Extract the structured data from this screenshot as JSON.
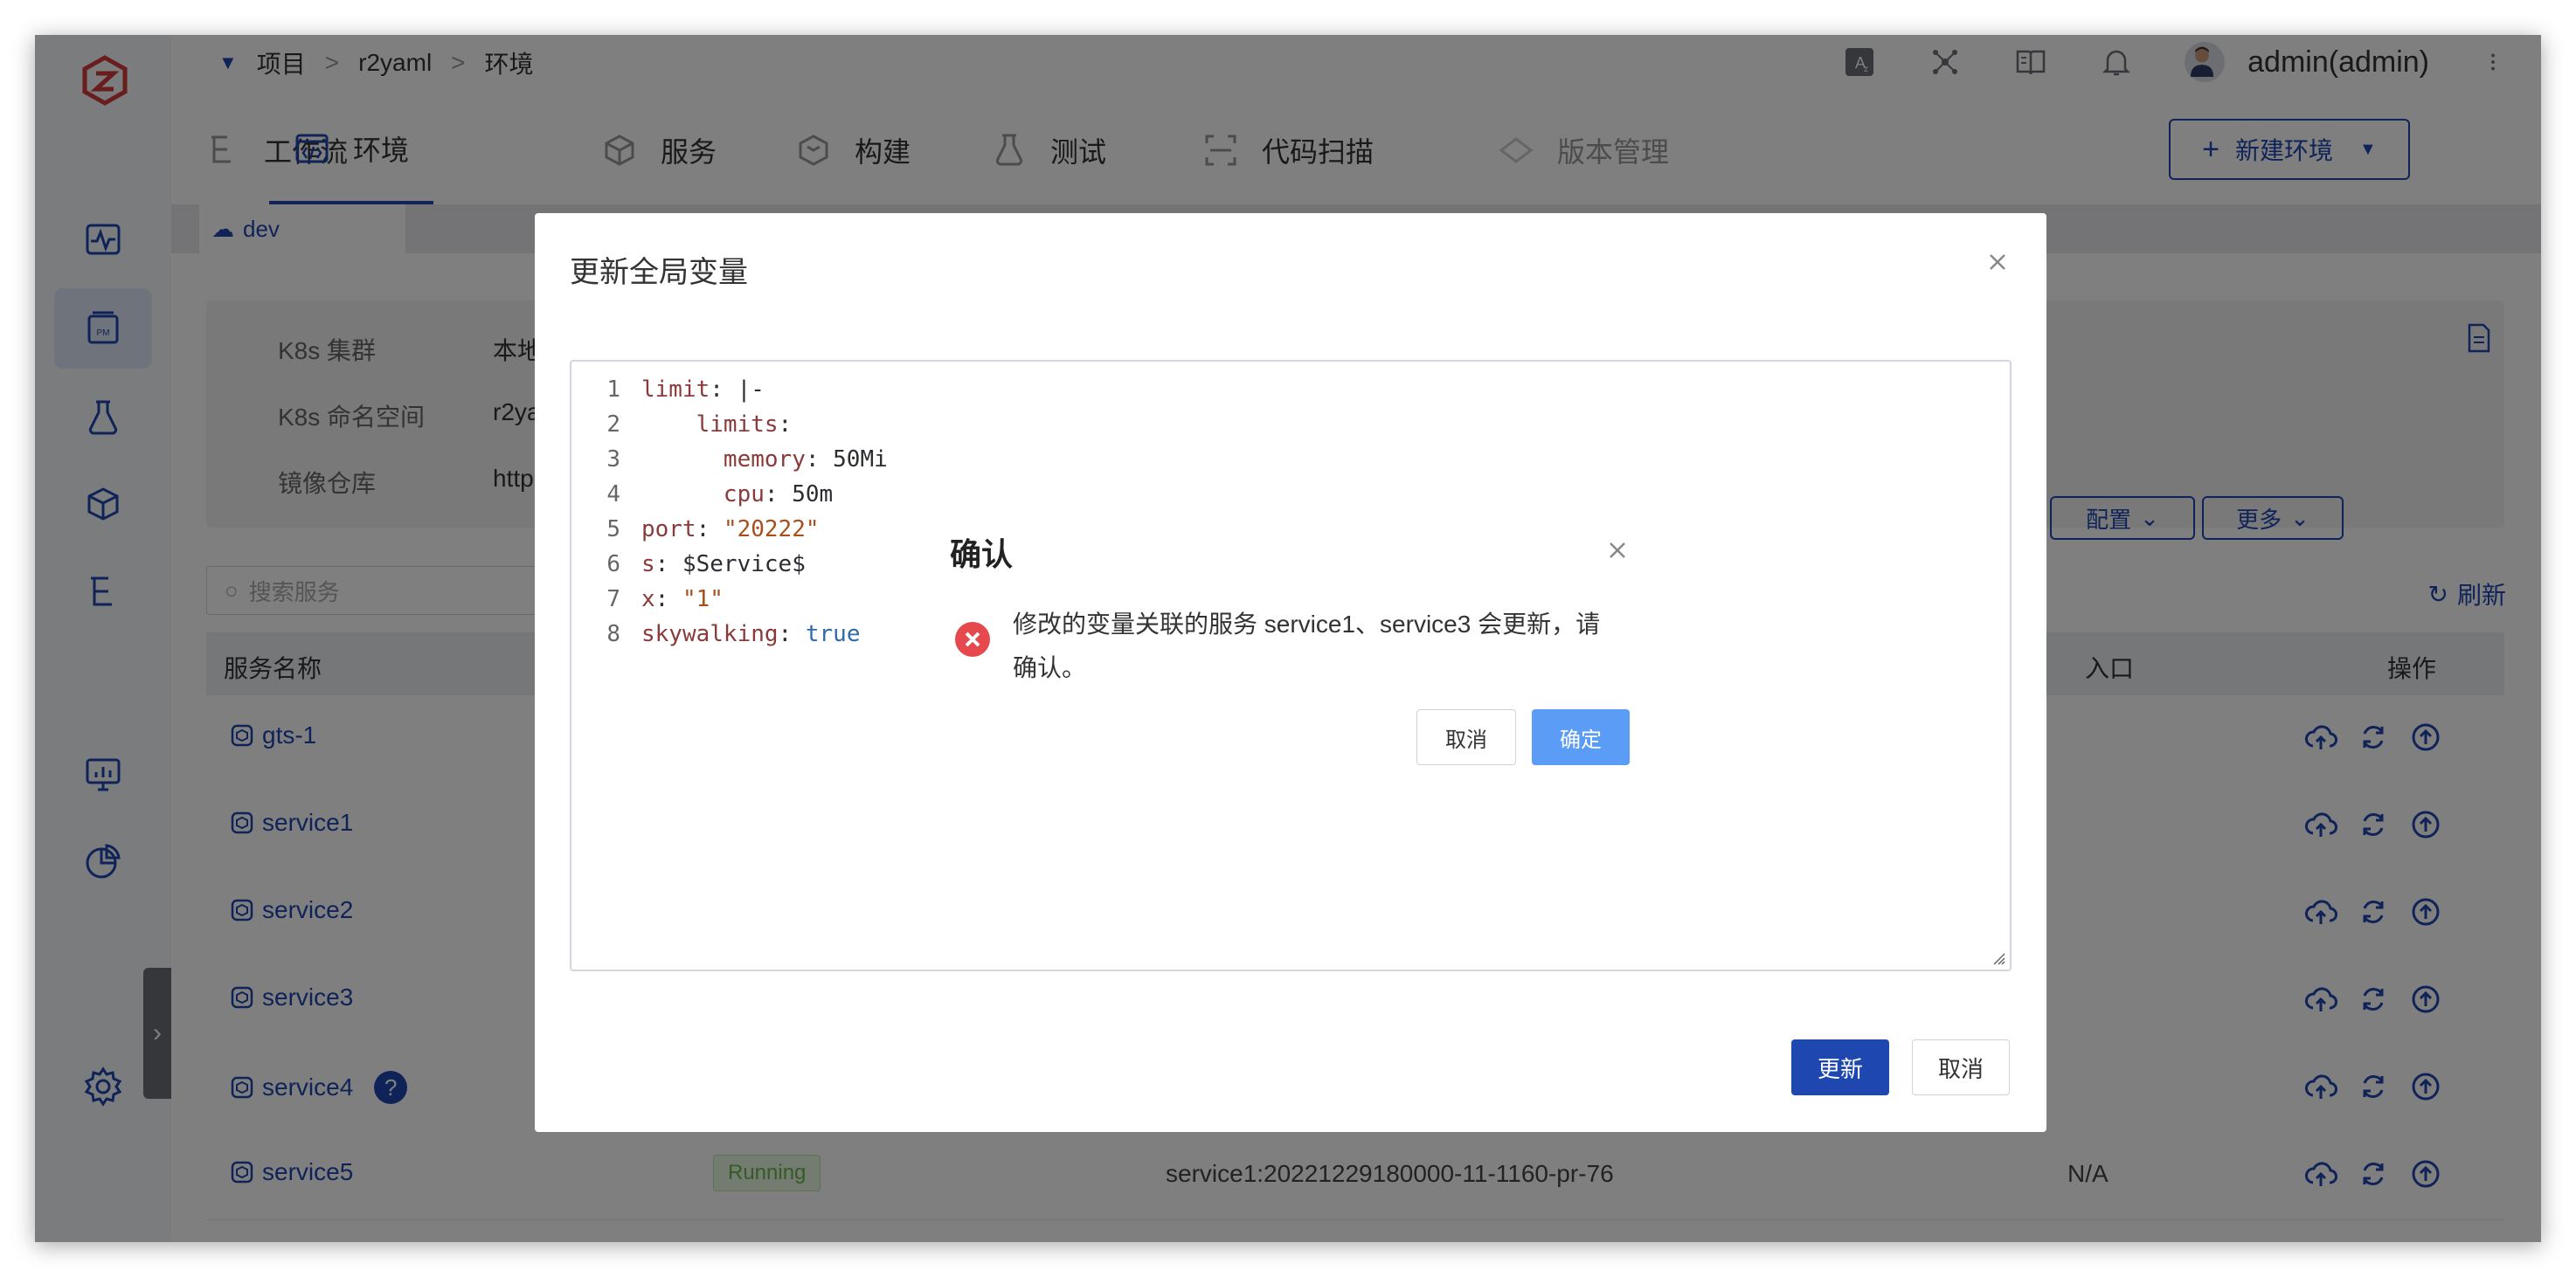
{
  "breadcrumb": {
    "items": [
      "项目",
      "r2yaml",
      "环境"
    ],
    "separator": ">"
  },
  "user": {
    "name": "admin(admin)"
  },
  "tabs": [
    {
      "label": "工作流",
      "icon": "workflow-icon"
    },
    {
      "label": "环境",
      "icon": "code-icon",
      "active": true
    },
    {
      "label": "服务",
      "icon": "cube-icon"
    },
    {
      "label": "构建",
      "icon": "build-icon"
    },
    {
      "label": "测试",
      "icon": "flask-icon"
    },
    {
      "label": "代码扫描",
      "icon": "scan-icon"
    },
    {
      "label": "版本管理",
      "icon": "diamond-icon"
    }
  ],
  "new_env_button": "新建环境",
  "env": {
    "name": "dev"
  },
  "info": {
    "cluster_label": "K8s 集群",
    "cluster_value": "本地",
    "namespace_label": "K8s 命名空间",
    "namespace_value": "r2ya",
    "registry_label": "镜像仓库",
    "registry_value": "http"
  },
  "config_button": "配置",
  "more_button": "更多",
  "search": {
    "placeholder": "搜索服务"
  },
  "refresh_label": "刷新",
  "table": {
    "headers": {
      "name": "服务名称",
      "entry": "入口",
      "ops": "操作"
    },
    "rows": [
      {
        "name": "gts-1"
      },
      {
        "name": "service1"
      },
      {
        "name": "service2"
      },
      {
        "name": "service3"
      },
      {
        "name": "service4",
        "help": "?"
      },
      {
        "name": "service5",
        "status": "Running",
        "image": "service1:20221229180000-11-1160-pr-76",
        "entry": "N/A"
      }
    ]
  },
  "modal": {
    "title": "更新全局变量",
    "code": [
      {
        "n": "1",
        "parts": [
          {
            "t": "limit",
            "c": "k"
          },
          {
            "t": ": |-",
            "c": ""
          }
        ]
      },
      {
        "n": "2",
        "parts": [
          {
            "t": "    ",
            "c": ""
          },
          {
            "t": "limits",
            "c": "k"
          },
          {
            "t": ":",
            "c": ""
          }
        ]
      },
      {
        "n": "3",
        "parts": [
          {
            "t": "      ",
            "c": ""
          },
          {
            "t": "memory",
            "c": "k"
          },
          {
            "t": ": 50Mi",
            "c": ""
          }
        ]
      },
      {
        "n": "4",
        "parts": [
          {
            "t": "      ",
            "c": ""
          },
          {
            "t": "cpu",
            "c": "k"
          },
          {
            "t": ": 50m",
            "c": ""
          }
        ]
      },
      {
        "n": "5",
        "parts": [
          {
            "t": "port",
            "c": "k"
          },
          {
            "t": ": ",
            "c": ""
          },
          {
            "t": "\"20222\"",
            "c": "s"
          }
        ]
      },
      {
        "n": "6",
        "parts": [
          {
            "t": "s",
            "c": "k"
          },
          {
            "t": ": $Service$",
            "c": ""
          }
        ]
      },
      {
        "n": "7",
        "parts": [
          {
            "t": "x",
            "c": "k"
          },
          {
            "t": ": ",
            "c": ""
          },
          {
            "t": "\"1\"",
            "c": "s"
          }
        ]
      },
      {
        "n": "8",
        "parts": [
          {
            "t": "skywalking",
            "c": "k"
          },
          {
            "t": ": ",
            "c": ""
          },
          {
            "t": "true",
            "c": "b"
          }
        ]
      }
    ],
    "update_button": "更新",
    "cancel_button": "取消"
  },
  "confirm": {
    "title": "确认",
    "message": "修改的变量关联的服务 service1、service3 会更新，请确认。",
    "cancel": "取消",
    "ok": "确定"
  },
  "colors": {
    "accent": "#1f47b0",
    "danger": "#e5484d",
    "confirm_ok": "#5b9cf6"
  }
}
